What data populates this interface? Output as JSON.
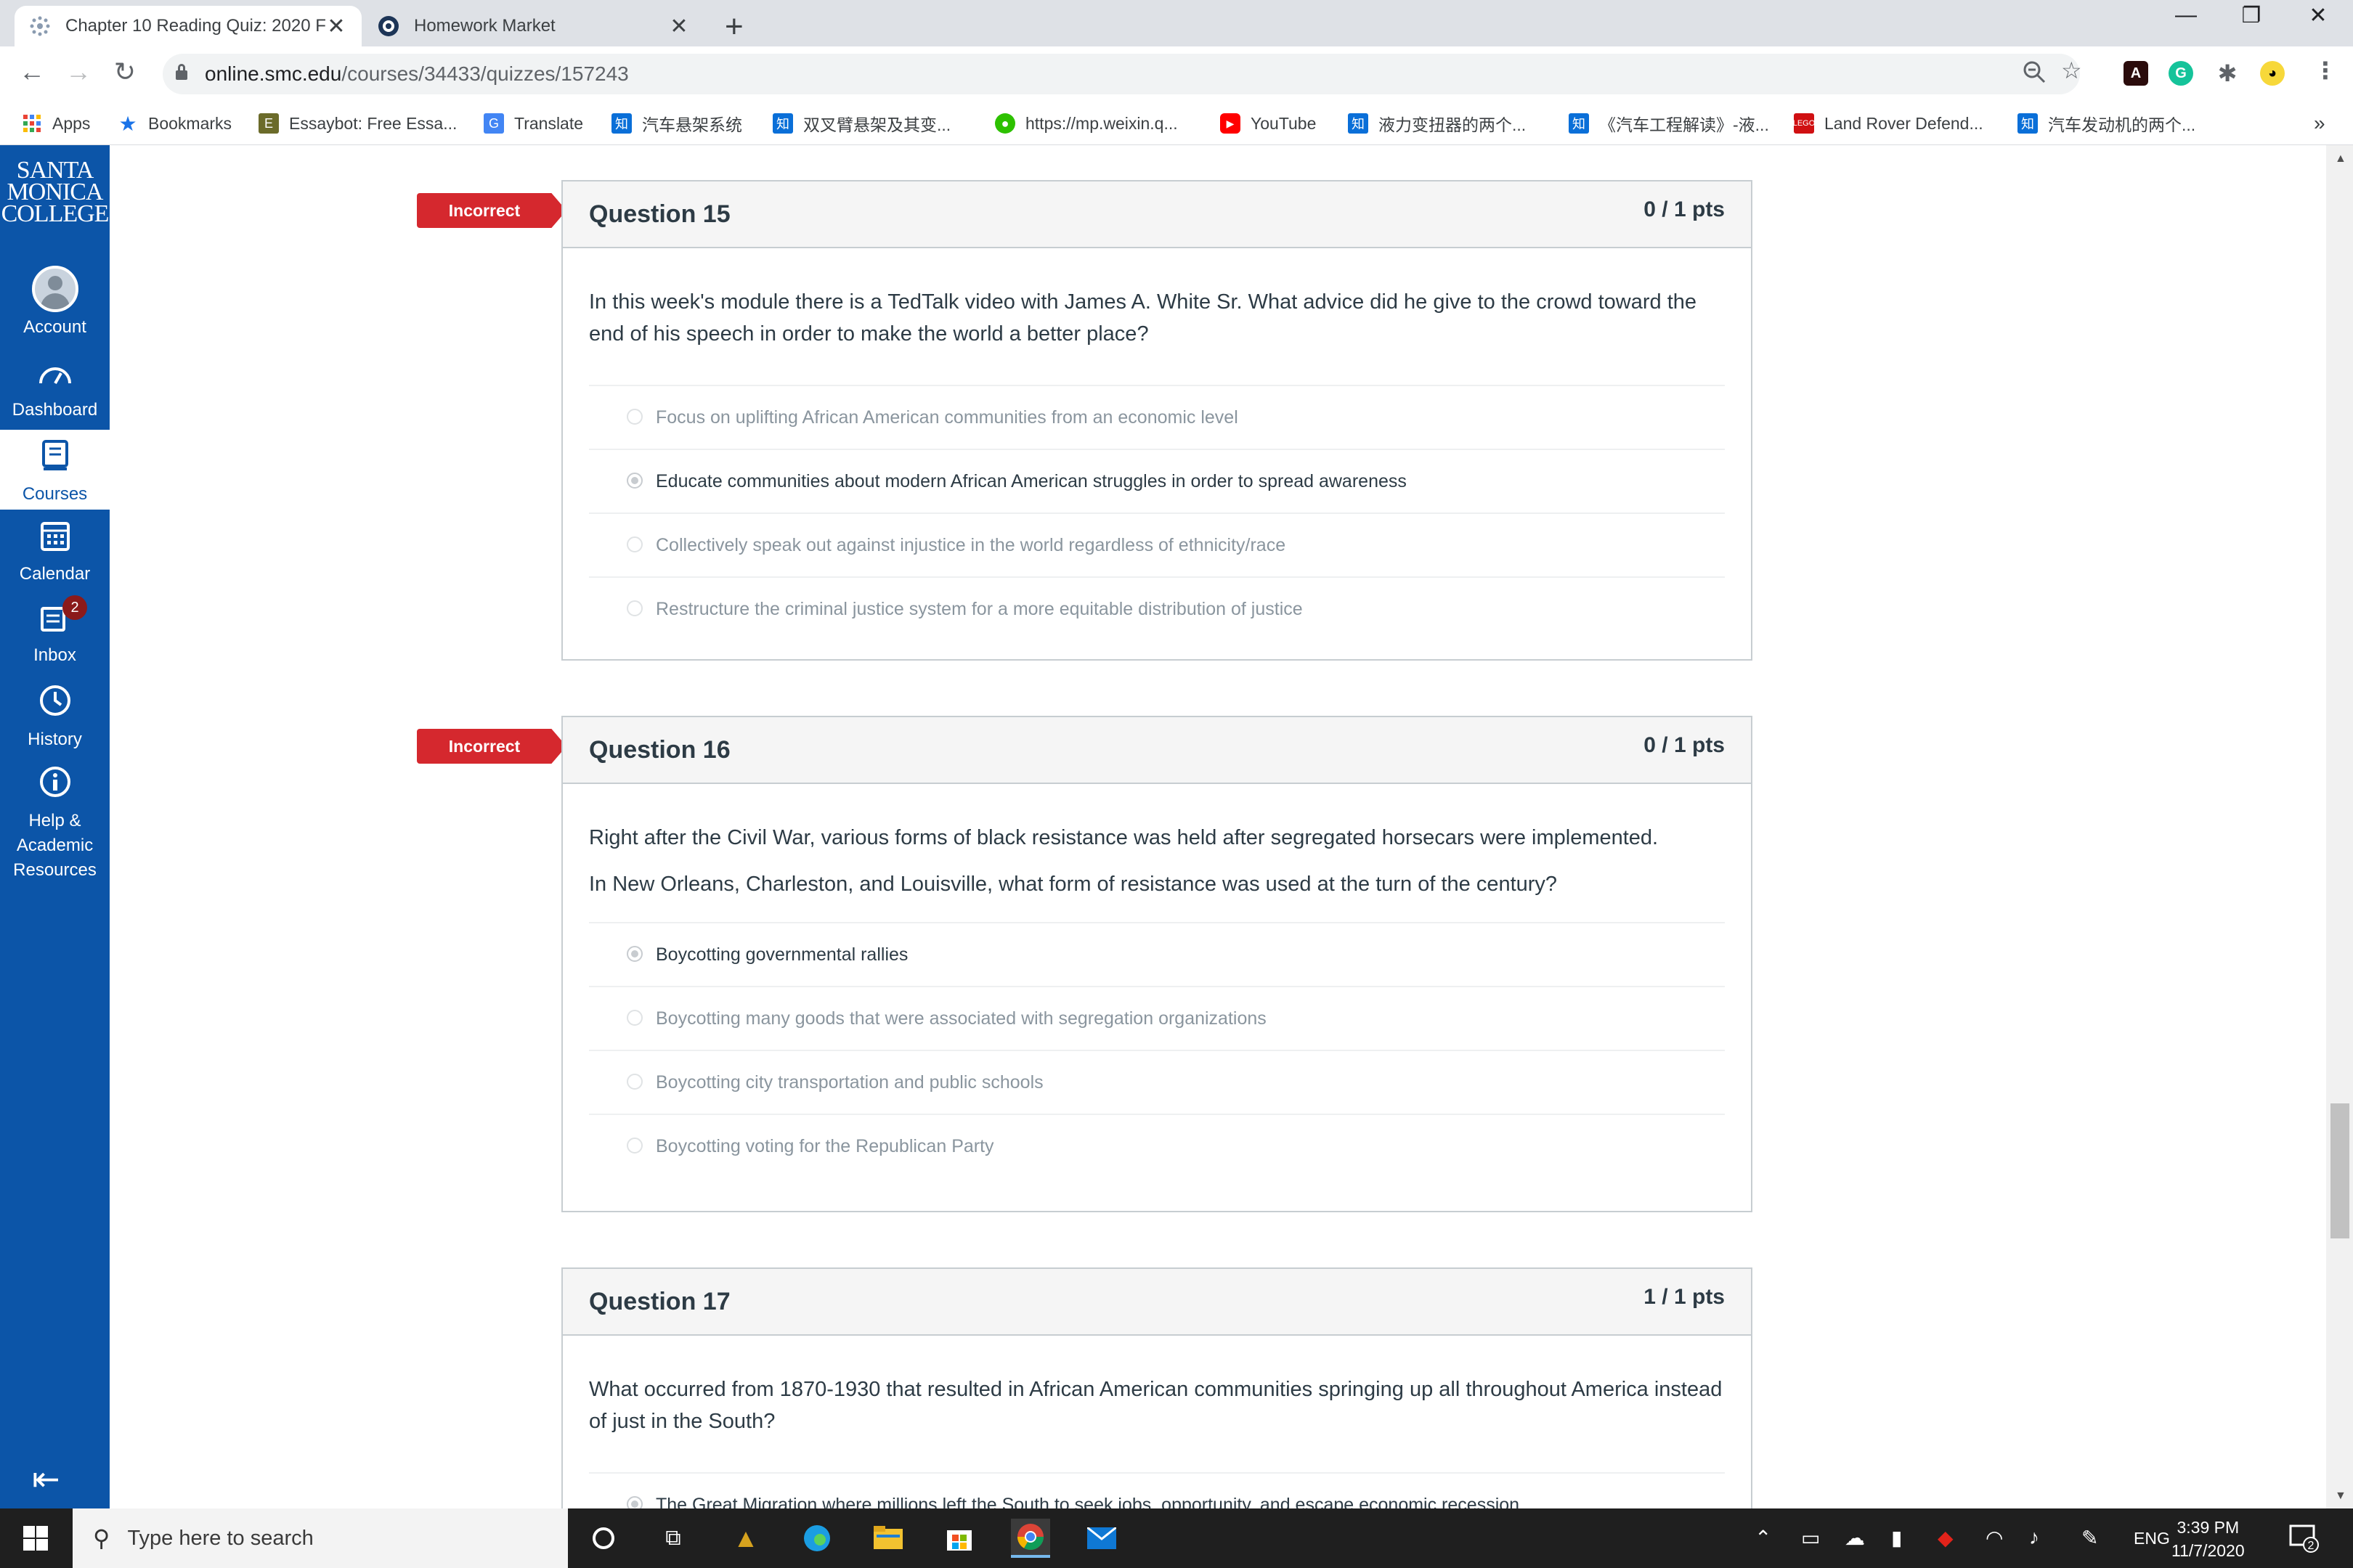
{
  "browser": {
    "tabs": [
      {
        "title": "Chapter 10 Reading Quiz: 2020 F",
        "active": true
      },
      {
        "title": "Homework Market",
        "active": false
      }
    ],
    "new_tab": "+",
    "window_controls": {
      "minimize": "—",
      "restore": "❐",
      "close": "✕"
    },
    "url_host": "online.smc.edu",
    "url_path": "/courses/34433/quizzes/157243"
  },
  "bookmarks": [
    {
      "label": "Apps"
    },
    {
      "label": "Bookmarks"
    },
    {
      "label": "Essaybot: Free Essa..."
    },
    {
      "label": "Translate"
    },
    {
      "label": "汽车悬架系统"
    },
    {
      "label": "双叉臂悬架及其变..."
    },
    {
      "label": "https://mp.weixin.q..."
    },
    {
      "label": "YouTube"
    },
    {
      "label": "液力变扭器的两个..."
    },
    {
      "label": "《汽车工程解读》-液..."
    },
    {
      "label": "Land Rover Defend..."
    },
    {
      "label": "汽车发动机的两个..."
    }
  ],
  "bookmarks_more": "»",
  "canvas_nav": {
    "logo_lines": [
      "SANTA",
      "MONICA",
      "COLLEGE"
    ],
    "items": [
      {
        "label": "Account"
      },
      {
        "label": "Dashboard"
      },
      {
        "label": "Courses"
      },
      {
        "label": "Calendar"
      },
      {
        "label": "Inbox",
        "badge": "2"
      },
      {
        "label": "History"
      },
      {
        "label": "Help & Academic Resources"
      }
    ]
  },
  "quiz": {
    "questions": [
      {
        "title": "Question 15",
        "points": "0 / 1 pts",
        "flag": "Incorrect",
        "text": [
          "In this week's module there is a TedTalk video with James A. White Sr. What advice did he give to the crowd toward the end of his speech in order to make the world a better place?"
        ],
        "answers": [
          "Focus on uplifting African American communities from an economic level",
          "Educate communities about modern African American struggles in order to spread awareness",
          "Collectively speak out against injustice in the world regardless of ethnicity/race",
          "Restructure the criminal justice system for a more equitable distribution of justice"
        ]
      },
      {
        "title": "Question 16",
        "points": "0 / 1 pts",
        "flag": "Incorrect",
        "text": [
          "Right after the Civil War, various forms of black resistance was held after segregated horsecars were implemented.",
          "In New Orleans, Charleston, and Louisville, what form of resistance was used at the turn of the century?"
        ],
        "answers": [
          "Boycotting governmental rallies",
          "Boycotting many goods that were associated with segregation organizations",
          "Boycotting city transportation and public schools",
          "Boycotting voting for the Republican Party"
        ]
      },
      {
        "title": "Question 17",
        "points": "1 / 1 pts",
        "text": [
          "What occurred from 1870-1930 that resulted in African American communities springing up all throughout America instead of just in the South?"
        ],
        "answers": [
          "The Great Migration where millions left the South to seek jobs, opportunity, and escape economic recession"
        ]
      }
    ]
  },
  "taskbar": {
    "search_placeholder": "Type here to search",
    "language": "ENG",
    "time": "3:39 PM",
    "date": "11/7/2020",
    "notifications": "2"
  },
  "colors": {
    "canvas_nav": "#0c55a8",
    "incorrect_flag": "#d5282e",
    "tab_strip": "#dee1e6",
    "taskbar": "#1f1f1f"
  }
}
